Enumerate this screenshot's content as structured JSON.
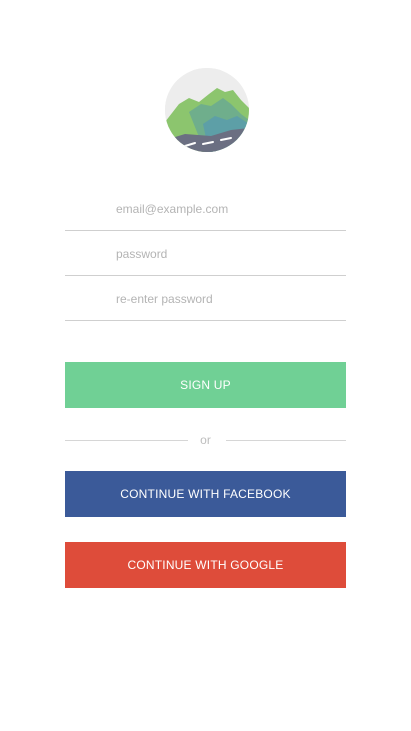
{
  "form": {
    "email_placeholder": "email@example.com",
    "email_value": "",
    "password_placeholder": "password",
    "password_value": "",
    "repassword_placeholder": "re-enter password",
    "repassword_value": ""
  },
  "buttons": {
    "signup_label": "SIGN UP",
    "facebook_label": "CONTINUE WITH FACEBOOK",
    "google_label": "CONTINUE WITH GOOGLE"
  },
  "divider": {
    "text": "or"
  },
  "logo": {
    "icon": "mountain-landscape-icon"
  },
  "colors": {
    "signup": "#70d095",
    "facebook": "#3b5a99",
    "google": "#de4c3a",
    "field_border": "#cfcfcf",
    "placeholder": "#b4b4b4"
  }
}
